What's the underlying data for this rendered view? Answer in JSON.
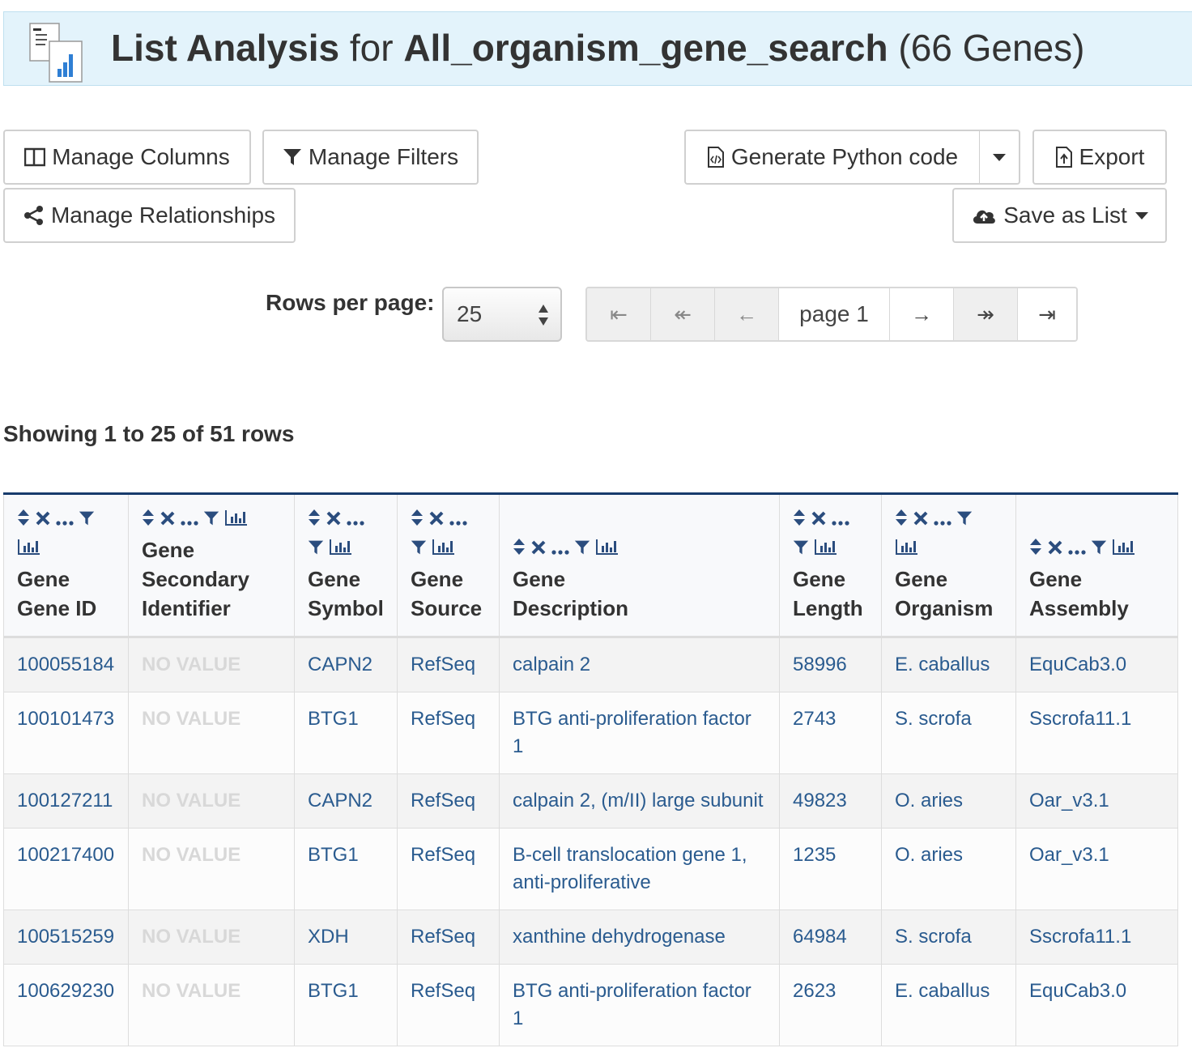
{
  "header": {
    "title": "List Analysis",
    "for_word": "for",
    "list_name": "All_organism_gene_search",
    "count": "(66 Genes)"
  },
  "toolbar": {
    "manage_columns": "Manage Columns",
    "manage_filters": "Manage Filters",
    "manage_relationships": "Manage Relationships",
    "generate_code": "Generate Python code",
    "export": "Export",
    "save_as_list": "Save as List"
  },
  "pagination": {
    "rows_label": "Rows per page:",
    "rows_value": "25",
    "first": "⇤",
    "prev_fast": "↞",
    "prev": "←",
    "page_label": "page 1",
    "next": "→",
    "next_fast": "↠",
    "last": "⇥"
  },
  "summary": "Showing 1 to 25 of 51 rows",
  "table": {
    "columns": [
      {
        "line1": "Gene",
        "line2": "Gene ID"
      },
      {
        "line1": "Gene",
        "line2": "Secondary",
        "line3": "Identifier"
      },
      {
        "line1": "Gene",
        "line2": "Symbol"
      },
      {
        "line1": "Gene",
        "line2": "Source"
      },
      {
        "line1": "Gene",
        "line2": "Description"
      },
      {
        "line1": "Gene",
        "line2": "Length"
      },
      {
        "line1": "Gene",
        "line2": "Organism"
      },
      {
        "line1": "Gene",
        "line2": "Assembly"
      }
    ],
    "rows": [
      [
        "100055184",
        "NO VALUE",
        "CAPN2",
        "RefSeq",
        "calpain 2",
        "58996",
        "E. caballus",
        "EquCab3.0"
      ],
      [
        "100101473",
        "NO VALUE",
        "BTG1",
        "RefSeq",
        "BTG anti-proliferation factor 1",
        "2743",
        "S. scrofa",
        "Sscrofa11.1"
      ],
      [
        "100127211",
        "NO VALUE",
        "CAPN2",
        "RefSeq",
        "calpain 2, (m/II) large subunit",
        "49823",
        "O. aries",
        "Oar_v3.1"
      ],
      [
        "100217400",
        "NO VALUE",
        "BTG1",
        "RefSeq",
        "B-cell translocation gene 1, anti-proliferative",
        "1235",
        "O. aries",
        "Oar_v3.1"
      ],
      [
        "100515259",
        "NO VALUE",
        "XDH",
        "RefSeq",
        "xanthine dehydrogenase",
        "64984",
        "S. scrofa",
        "Sscrofa11.1"
      ],
      [
        "100629230",
        "NO VALUE",
        "BTG1",
        "RefSeq",
        "BTG anti-proliferation factor 1",
        "2623",
        "E. caballus",
        "EquCab3.0"
      ]
    ]
  },
  "colors": {
    "header_bg": "#e3f3fb",
    "link": "#2a5b8f",
    "table_header_border": "#173b6c",
    "no_value": "#d8d8d8"
  }
}
